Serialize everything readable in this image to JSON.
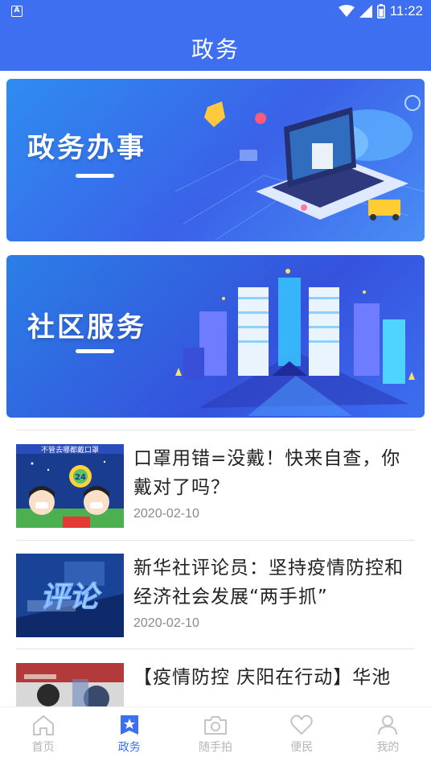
{
  "status_bar": {
    "left_icon": "A",
    "time": "11:22",
    "icons": [
      "wifi-icon",
      "cell-signal-icon",
      "battery-icon"
    ]
  },
  "app_bar": {
    "title": "政务"
  },
  "banners": [
    {
      "title": "政务办事",
      "icon": "government-affairs-illustration"
    },
    {
      "title": "社区服务",
      "icon": "community-city-illustration"
    }
  ],
  "news": [
    {
      "title": "口罩用错=没戴！快来自查，你戴对了吗？",
      "date": "2020-02-10",
      "thumb_caption": "不管去哪都戴口罩",
      "thumb_badge": "24"
    },
    {
      "title": "新华社评论员：坚持疫情防控和经济社会发展“两手抓”",
      "date": "2020-02-10",
      "thumb_caption": "评论"
    },
    {
      "title": "【疫情防控 庆阳在行动】华池",
      "date": ""
    }
  ],
  "tabs": [
    {
      "label": "首页",
      "icon": "home-icon",
      "active": false
    },
    {
      "label": "政务",
      "icon": "star-badge-icon",
      "active": true
    },
    {
      "label": "随手拍",
      "icon": "camera-icon",
      "active": false
    },
    {
      "label": "便民",
      "icon": "heart-icon",
      "active": false
    },
    {
      "label": "我的",
      "icon": "user-icon",
      "active": false
    }
  ],
  "colors": {
    "primary": "#3d6ff0",
    "tab_inactive": "#b5b5b5",
    "date_text": "#8a8a8a"
  }
}
